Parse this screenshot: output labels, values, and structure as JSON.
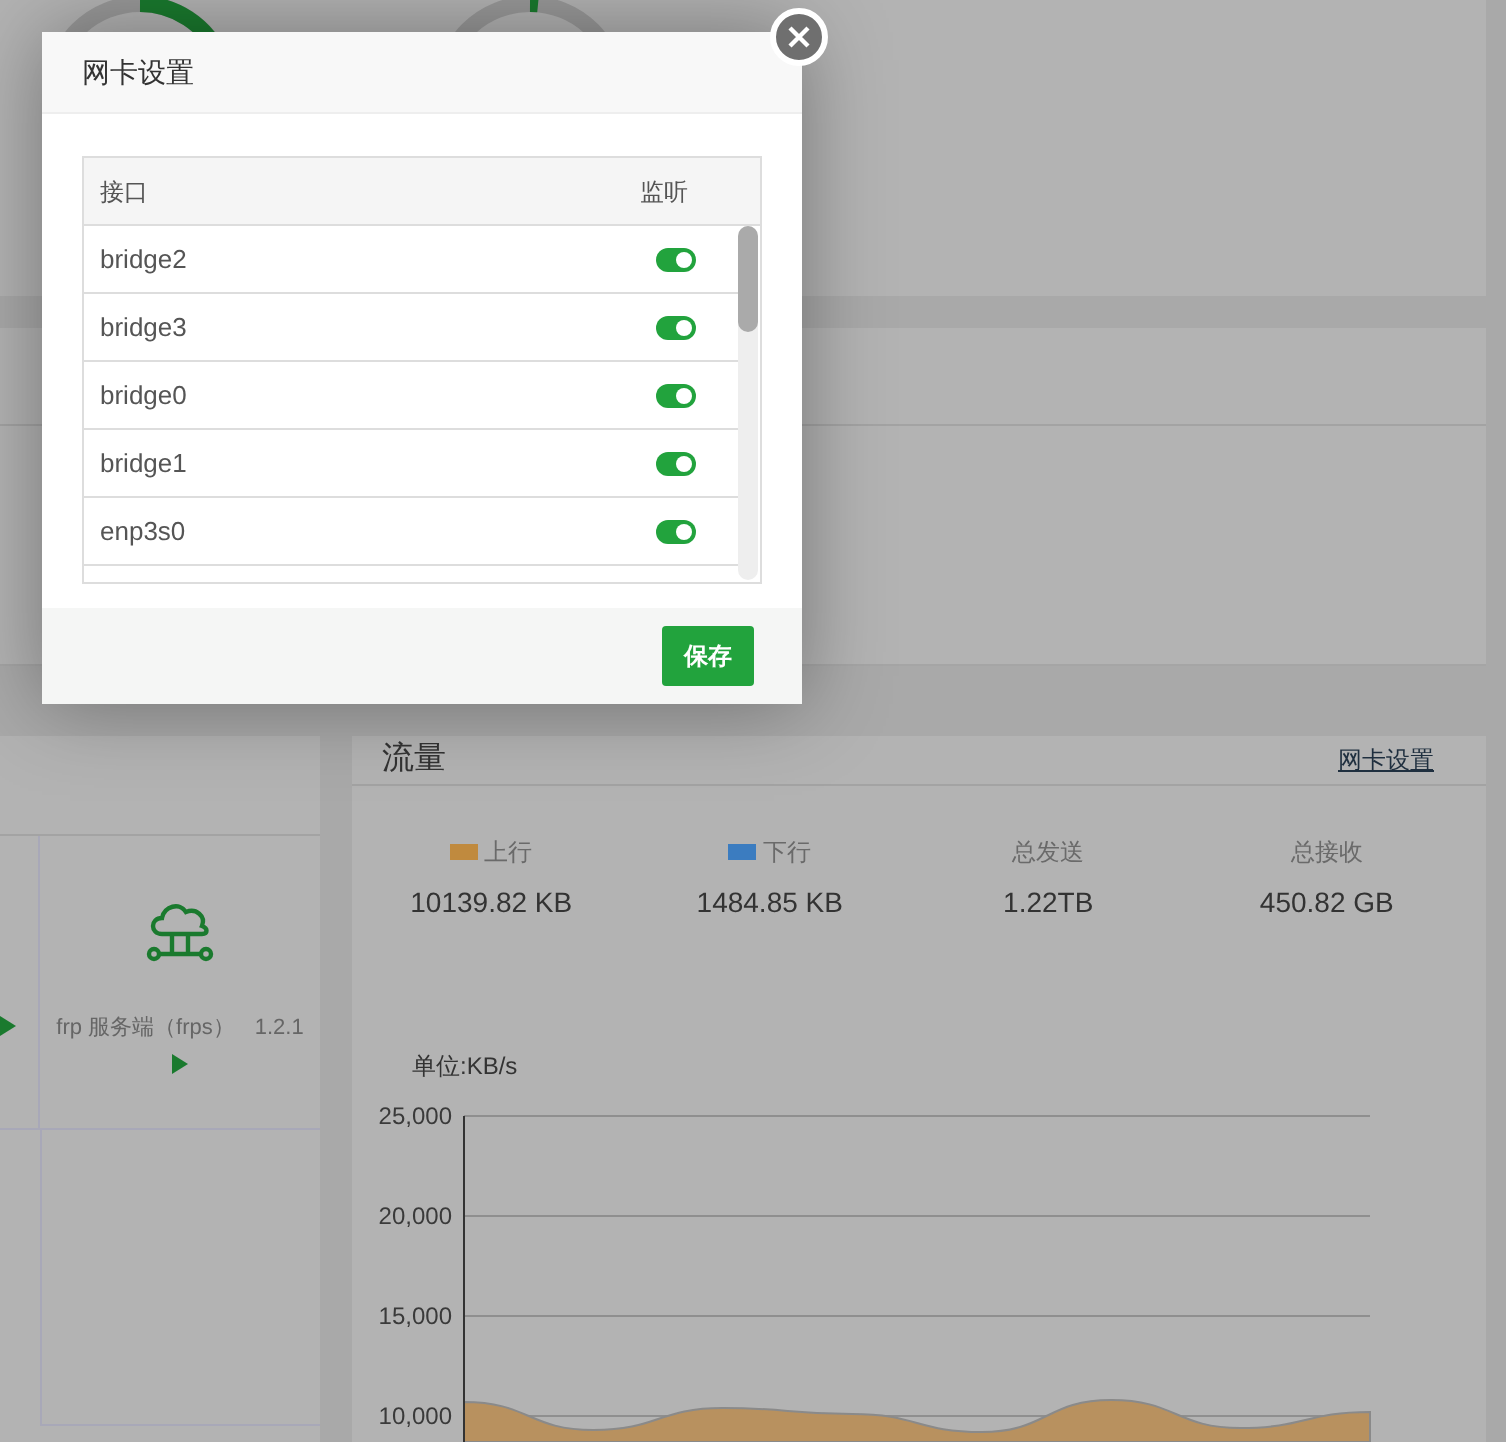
{
  "services": {
    "items": [
      {
        "name": "frp 服务端（frps）",
        "version": "1.2.1"
      }
    ]
  },
  "traffic": {
    "title": "流量",
    "settings_link": "网卡设置",
    "stats": [
      {
        "kind": "legend",
        "label": "上行",
        "value": "10139.82 KB",
        "color": "#c08a3e"
      },
      {
        "kind": "legend",
        "label": "下行",
        "value": "1484.85 KB",
        "color": "#3b7cc0"
      },
      {
        "kind": "plain",
        "label": "总发送",
        "value": "1.22TB"
      },
      {
        "kind": "plain",
        "label": "总接收",
        "value": "450.82 GB"
      }
    ],
    "chart_data": {
      "type": "area",
      "grid": true,
      "ylabel": "单位:KB/s",
      "ylim": [
        8700,
        25000
      ],
      "yticks": [
        {
          "value": 10000,
          "label": "10,000"
        },
        {
          "value": 15000,
          "label": "15,000"
        },
        {
          "value": 20000,
          "label": "20,000"
        },
        {
          "value": 25000,
          "label": "25,000"
        }
      ],
      "series": [
        {
          "color": "#b8915f",
          "values": [
            10700,
            9300,
            10400,
            10100,
            9200,
            10800,
            9400,
            10200
          ]
        }
      ]
    }
  },
  "dialog": {
    "title": "网卡设置",
    "columns": [
      "接口",
      "监听"
    ],
    "rows": [
      {
        "name": "bridge2",
        "on": true
      },
      {
        "name": "bridge3",
        "on": true
      },
      {
        "name": "bridge0",
        "on": true
      },
      {
        "name": "bridge1",
        "on": true
      },
      {
        "name": "enp3s0",
        "on": true
      }
    ],
    "save_button": "保存"
  }
}
